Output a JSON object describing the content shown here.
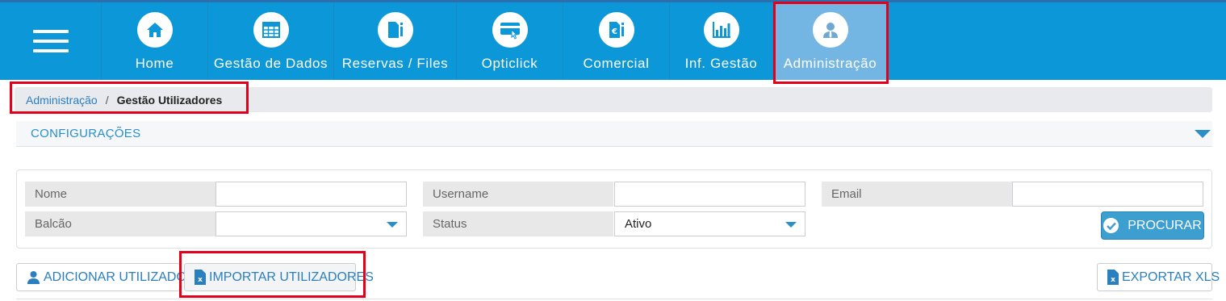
{
  "nav": {
    "menu_icon": "hamburger-icon",
    "items": [
      {
        "label": "Home",
        "icon": "home-icon"
      },
      {
        "label": "Gestão de Dados",
        "icon": "table-icon"
      },
      {
        "label": "Reservas / Files",
        "icon": "file-info-icon"
      },
      {
        "label": "Opticlick",
        "icon": "card-click-icon"
      },
      {
        "label": "Comercial",
        "icon": "euro-doc-icon"
      },
      {
        "label": "Inf. Gestão",
        "icon": "bar-chart-icon"
      },
      {
        "label": "Administração",
        "icon": "user-admin-icon",
        "active": true
      }
    ]
  },
  "breadcrumb": {
    "parent": "Administração",
    "separator": "/",
    "current": "Gestão Utilizadores"
  },
  "config": {
    "title": "CONFIGURAÇÕES"
  },
  "filters": {
    "nome": {
      "label": "Nome",
      "value": ""
    },
    "username": {
      "label": "Username",
      "value": ""
    },
    "email": {
      "label": "Email",
      "value": ""
    },
    "balcao": {
      "label": "Balcão",
      "value": ""
    },
    "status": {
      "label": "Status",
      "value": "Ativo"
    },
    "search_label": "PROCURAR"
  },
  "actions": {
    "add_user": "ADICIONAR UTILIZADOR",
    "import_users": "IMPORTAR UTILIZADORES",
    "export_xls": "EXPORTAR XLS"
  },
  "colors": {
    "nav_bg": "#0b97d8",
    "nav_active": "#74b6e3",
    "accent": "#2a8fc6",
    "highlight": "#e3001b"
  }
}
